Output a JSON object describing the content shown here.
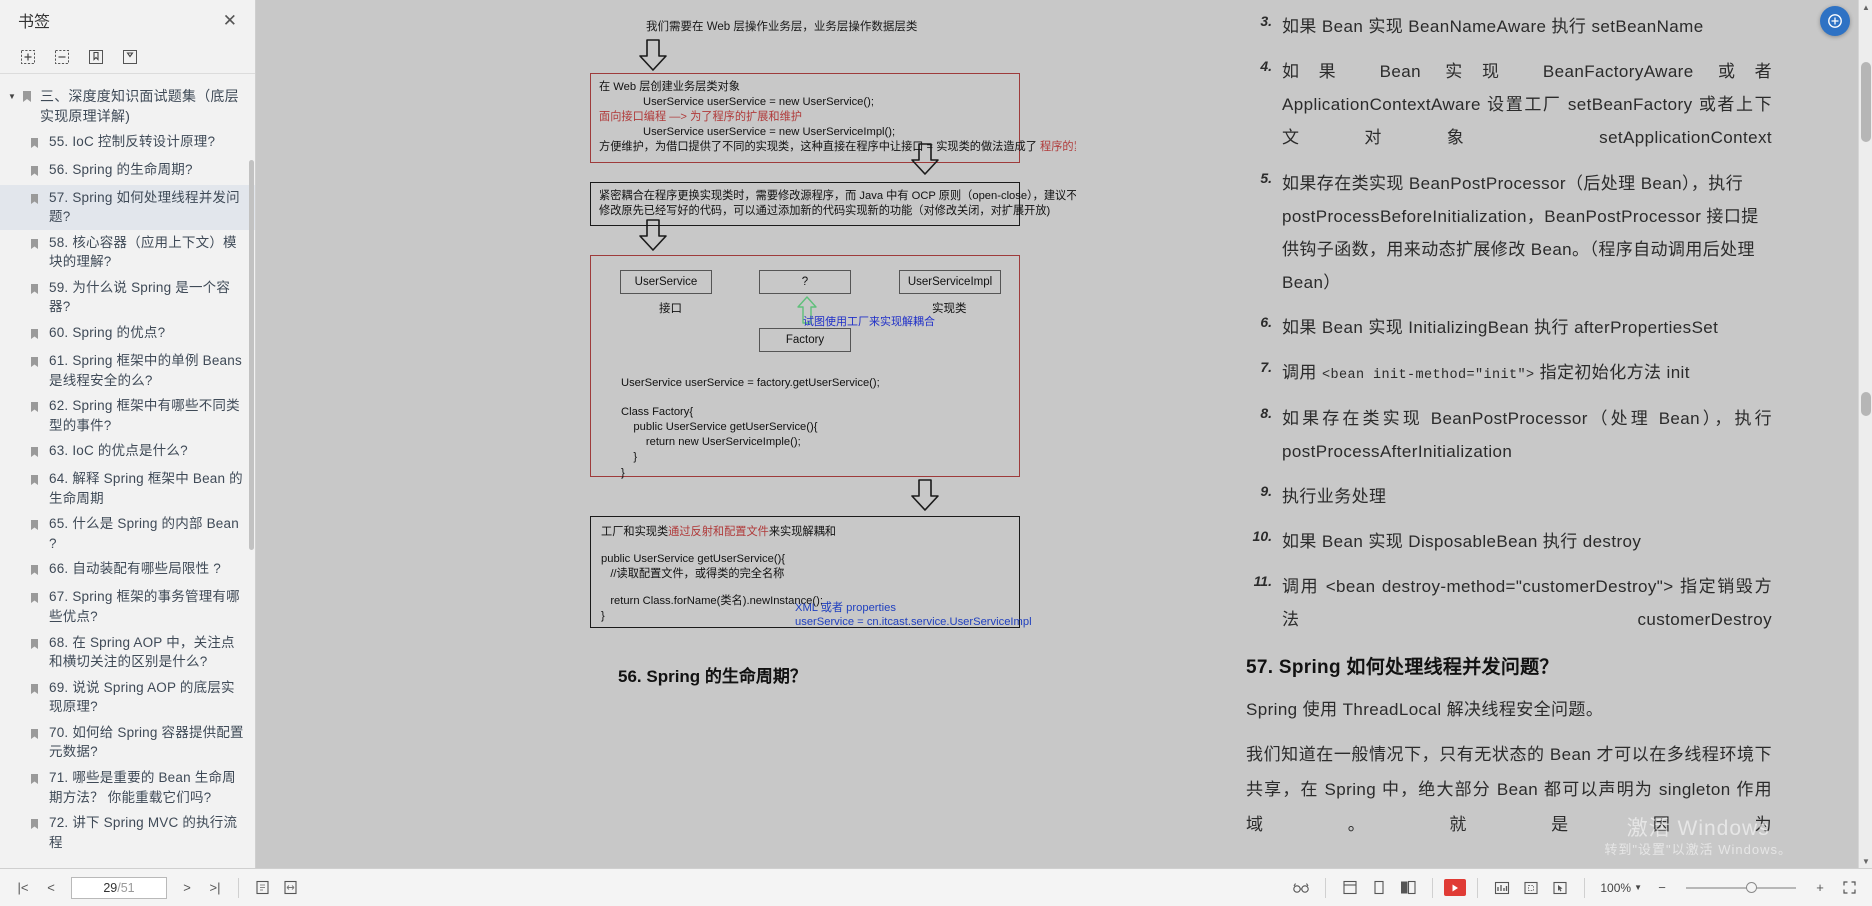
{
  "sidebar": {
    "title": "书签",
    "close_label": "✕",
    "tools": [
      {
        "name": "expand-all-icon",
        "label": "⊞"
      },
      {
        "name": "collapse-all-icon",
        "label": "⊟"
      },
      {
        "name": "add-bookmark-icon",
        "label": "⊕"
      },
      {
        "name": "remove-bookmark-icon",
        "label": "⊖"
      }
    ],
    "root": "三、深度度知识面试题集（底层实现原理详解)",
    "items": [
      {
        "label": "55. IoC 控制反转设计原理?",
        "active": false
      },
      {
        "label": "56. Spring 的生命周期?",
        "active": false
      },
      {
        "label": "57. Spring 如何处理线程并发问题?",
        "active": true
      },
      {
        "label": "58. 核心容器（应用上下文）模块的理解?",
        "active": false
      },
      {
        "label": "59. 为什么说 Spring 是一个容器?",
        "active": false
      },
      {
        "label": "60. Spring 的优点?",
        "active": false
      },
      {
        "label": "61. Spring 框架中的单例 Beans 是线程安全的么?",
        "active": false
      },
      {
        "label": "62. Spring 框架中有哪些不同类型的事件?",
        "active": false
      },
      {
        "label": "63. IoC 的优点是什么?",
        "active": false
      },
      {
        "label": "64. 解释 Spring 框架中 Bean 的生命周期",
        "active": false
      },
      {
        "label": "65. 什么是 Spring 的内部 Bean ?",
        "active": false
      },
      {
        "label": "66. 自动装配有哪些局限性 ?",
        "active": false
      },
      {
        "label": "67. Spring 框架的事务管理有哪些优点?",
        "active": false
      },
      {
        "label": "68. 在 Spring AOP 中，关注点和横切关注的区别是什么?",
        "active": false
      },
      {
        "label": "69. 说说 Spring AOP 的底层实现原理?",
        "active": false
      },
      {
        "label": "70. 如何给 Spring 容器提供配置元数据?",
        "active": false
      },
      {
        "label": "71. 哪些是重要的 Bean 生命周期方法？ 你能重载它们吗?",
        "active": false
      },
      {
        "label": "72. 讲下 Spring MVC 的执行流程",
        "active": false
      }
    ]
  },
  "left_page": {
    "caption_top": "我们需要在 Web 层操作业务层，业务层操作数据层类",
    "box1": {
      "lines": [
        {
          "text": "在 Web 层创建业务层类对象",
          "style": "plain"
        },
        {
          "text": "UserService userService = new UserService();",
          "style": "indent"
        },
        {
          "text": "面向接口编程 —> 为了程序的扩展和维护",
          "style": "red"
        },
        {
          "text": "UserService userService = new UserServiceImpl();",
          "style": "indent"
        },
        {
          "text_pre": "方便维护，为借口提供了不同的实现类，这种直接在程序中让接口 = 实现类的做法造成了 ",
          "text_red": "程序的紧密耦合",
          "style": "mixed"
        }
      ]
    },
    "box2": {
      "lines": [
        "紧密耦合在程序更换实现类时，需要修改源程序，而 Java 中有 OCP 原则（open-close），建议不需",
        "修改原先已经写好的代码，可以通过添加新的代码实现新的功能（对修改关闭，对扩展开放)"
      ]
    },
    "box3": {
      "nodes": [
        {
          "label": "UserService",
          "sub": "接口"
        },
        {
          "label": "?",
          "sub": ""
        },
        {
          "label": "UserServiceImpl",
          "sub": "实现类"
        },
        {
          "label": "Factory",
          "sub": ""
        }
      ],
      "note": "试图使用工厂来实现解耦合",
      "code": [
        "UserService userService = factory.getUserService();",
        "",
        "Class Factory{",
        "    public UserService getUserService(){",
        "        return new UserServiceImple();",
        "    }",
        "}"
      ]
    },
    "box4": {
      "title_pre": "工厂和实现类",
      "title_red": "通过反射和配置文件",
      "title_post": "来实现解耦和",
      "code": [
        "public UserService getUserService(){",
        "   //读取配置文件，或得类的完全名称",
        "",
        "   return Class.forName(类名).newInstance();",
        "}"
      ],
      "blue1": "XML 或者 properties",
      "blue2": "userService = cn.itcast.service.UserServiceImpl"
    },
    "heading_56": "56. Spring 的生命周期？"
  },
  "right_page": {
    "list": [
      {
        "num": "3.",
        "text": "如果 Bean 实现 BeanNameAware 执行 setBeanName",
        "justify": false
      },
      {
        "num": "4.",
        "text": "如果 Bean 实现 BeanFactoryAware 或者 ApplicationContextAware 设置工厂 setBeanFactory 或者上下文对象 setApplicationContext",
        "justify": true
      },
      {
        "num": "5.",
        "text": "如果存在类实现 BeanPostProcessor（后处理 Bean），执行 postProcessBeforeInitialization，BeanPostProcessor 接口提供钩子函数，用来动态扩展修改 Bean。（程序自动调用后处理 Bean）",
        "justify": false
      },
      {
        "num": "6.",
        "text": "如果 Bean 实现 InitializingBean 执行 afterPropertiesSet",
        "justify": false
      },
      {
        "num": "7.",
        "text": "调用 <bean init-method=\"init\"> 指定初始化方法 init",
        "justify": false,
        "mono_part": "<bean init-method=\"init\">"
      },
      {
        "num": "8.",
        "text": "如果存在类实现 BeanPostProcessor（处理 Bean），执行 postProcessAfterInitialization",
        "justify": true
      },
      {
        "num": "9.",
        "text": "执行业务处理",
        "justify": false
      },
      {
        "num": "10.",
        "text": "如果 Bean 实现 DisposableBean 执行 destroy",
        "justify": false
      },
      {
        "num": "11.",
        "text": "调用 <bean destroy-method=\"customerDestroy\"> 指定销毁方法 customerDestroy",
        "justify": true,
        "mono_part": "<bean  destroy-method=\"customerDestroy\">"
      }
    ],
    "heading_57": "57. Spring 如何处理线程并发问题？",
    "para1": "Spring 使用 ThreadLocal 解决线程安全问题。",
    "para2": "我们知道在一般情况下，只有无状态的 Bean 才可以在多线程环境下共享，在 Spring 中，绝大部分 Bean 都可以声明为 singleton 作用域。就是因为",
    "watermark_line1": "激活 Windows",
    "watermark_line2": "转到\"设置\"以激活 Windows。"
  },
  "toolbar": {
    "first_page_icon": "|<",
    "prev_page_icon": "<",
    "page_current": "29",
    "page_total": "/51",
    "next_page_icon": ">",
    "last_page_icon": ">|",
    "fit_page_icon": "⊡",
    "fit_width_icon": "⊞",
    "reading_mode_icon": "👓",
    "single_page_icon": "▤",
    "continuous_icon": "▯",
    "facing_icon": "▮▮",
    "play_icon": "▶",
    "chart_icon": "▤",
    "crop_icon": "⧉",
    "select_icon": "⌖",
    "zoom_level": "100%",
    "zoom_out_icon": "−",
    "zoom_in_icon": "+",
    "fullscreen_icon": "⛶"
  },
  "colors": {
    "accent": "#2e72c4",
    "red_box": "#9e3b3b",
    "red_text": "#b03a3a",
    "blue_text": "#1f3fbf",
    "page_bg": "#c8c8c8",
    "sidebar_bg": "#f2f2f2",
    "active_item": "#e2e6ec",
    "play_red": "#e03b35"
  }
}
